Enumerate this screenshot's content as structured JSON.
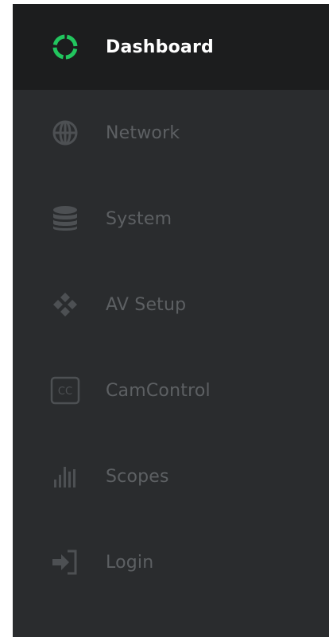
{
  "colors": {
    "sidebar_bg": "#2a2c2e",
    "active_bg": "#1c1d1e",
    "active_text": "#ffffff",
    "inactive_text": "#5d6063",
    "accent": "#22c55e"
  },
  "sidebar": {
    "items": [
      {
        "label": "Dashboard",
        "icon": "dashboard-ring-icon",
        "active": true
      },
      {
        "label": "Network",
        "icon": "globe-icon",
        "active": false
      },
      {
        "label": "System",
        "icon": "database-icon",
        "active": false
      },
      {
        "label": "AV Setup",
        "icon": "diamond-cluster-icon",
        "active": false
      },
      {
        "label": "CamControl",
        "icon": "cc-box-icon",
        "active": false
      },
      {
        "label": "Scopes",
        "icon": "bars-icon",
        "active": false
      },
      {
        "label": "Login",
        "icon": "login-icon",
        "active": false
      }
    ]
  }
}
